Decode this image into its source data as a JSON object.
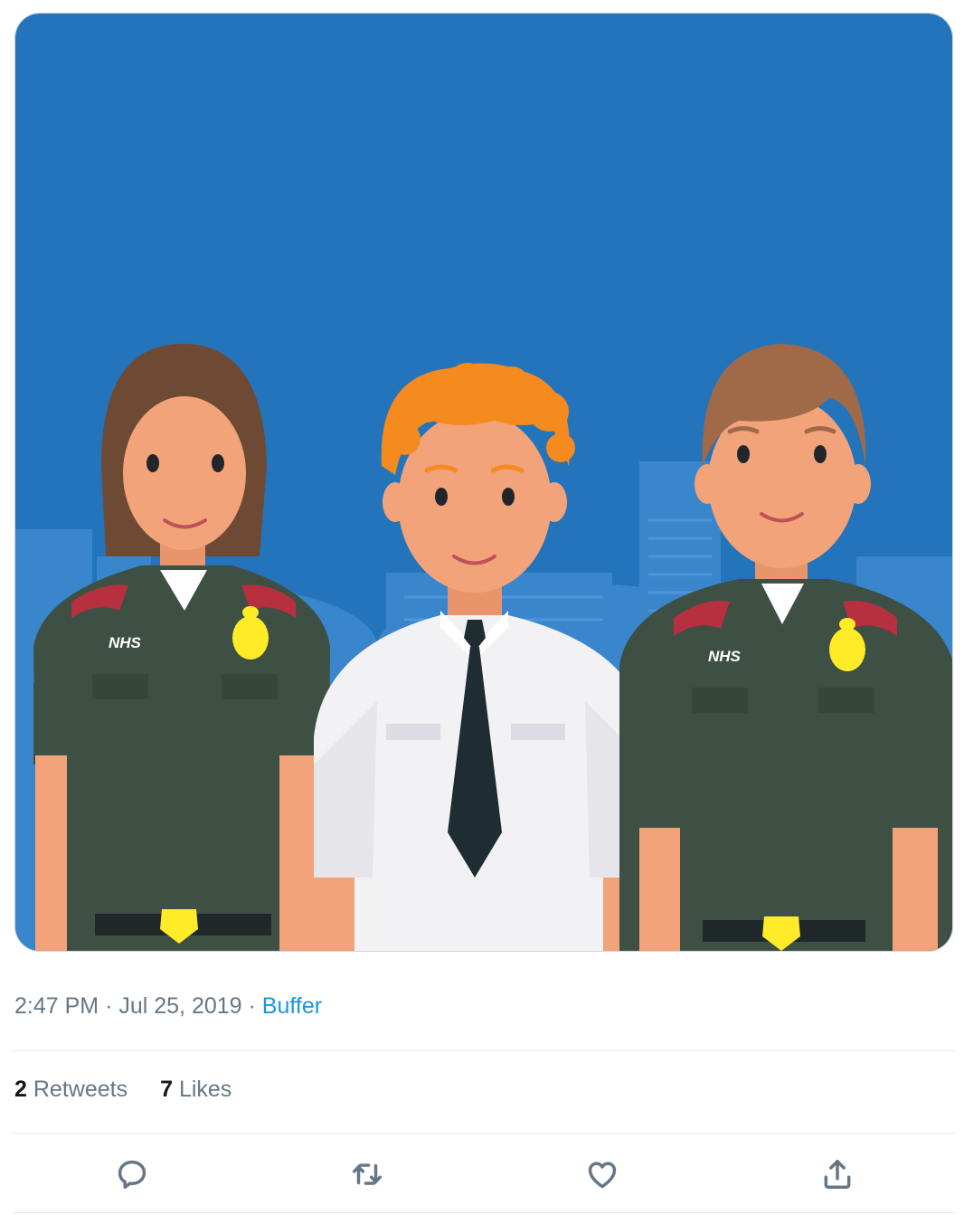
{
  "tweet": {
    "media": {
      "alt": "",
      "badge_text_left": "NHS",
      "badge_text_right": "NHS",
      "colors": {
        "background": "#2474bc",
        "skyline": "#3a86cc",
        "uniform": "#3e4f44",
        "shirt": "#f2f2f4",
        "tie": "#1f2d33",
        "skin": "#f2a37a",
        "badge": "#ffeb28"
      }
    },
    "meta": {
      "time": "2:47 PM",
      "separator": "·",
      "date": "Jul 25, 2019",
      "source": "Buffer"
    },
    "stats": {
      "retweets_count": "2",
      "retweets_label": "Retweets",
      "likes_count": "7",
      "likes_label": "Likes"
    },
    "actions": [
      {
        "name": "reply",
        "icon": "speech-bubble-icon"
      },
      {
        "name": "retweet",
        "icon": "retweet-icon"
      },
      {
        "name": "like",
        "icon": "heart-icon"
      },
      {
        "name": "share",
        "icon": "share-upload-icon"
      }
    ]
  }
}
